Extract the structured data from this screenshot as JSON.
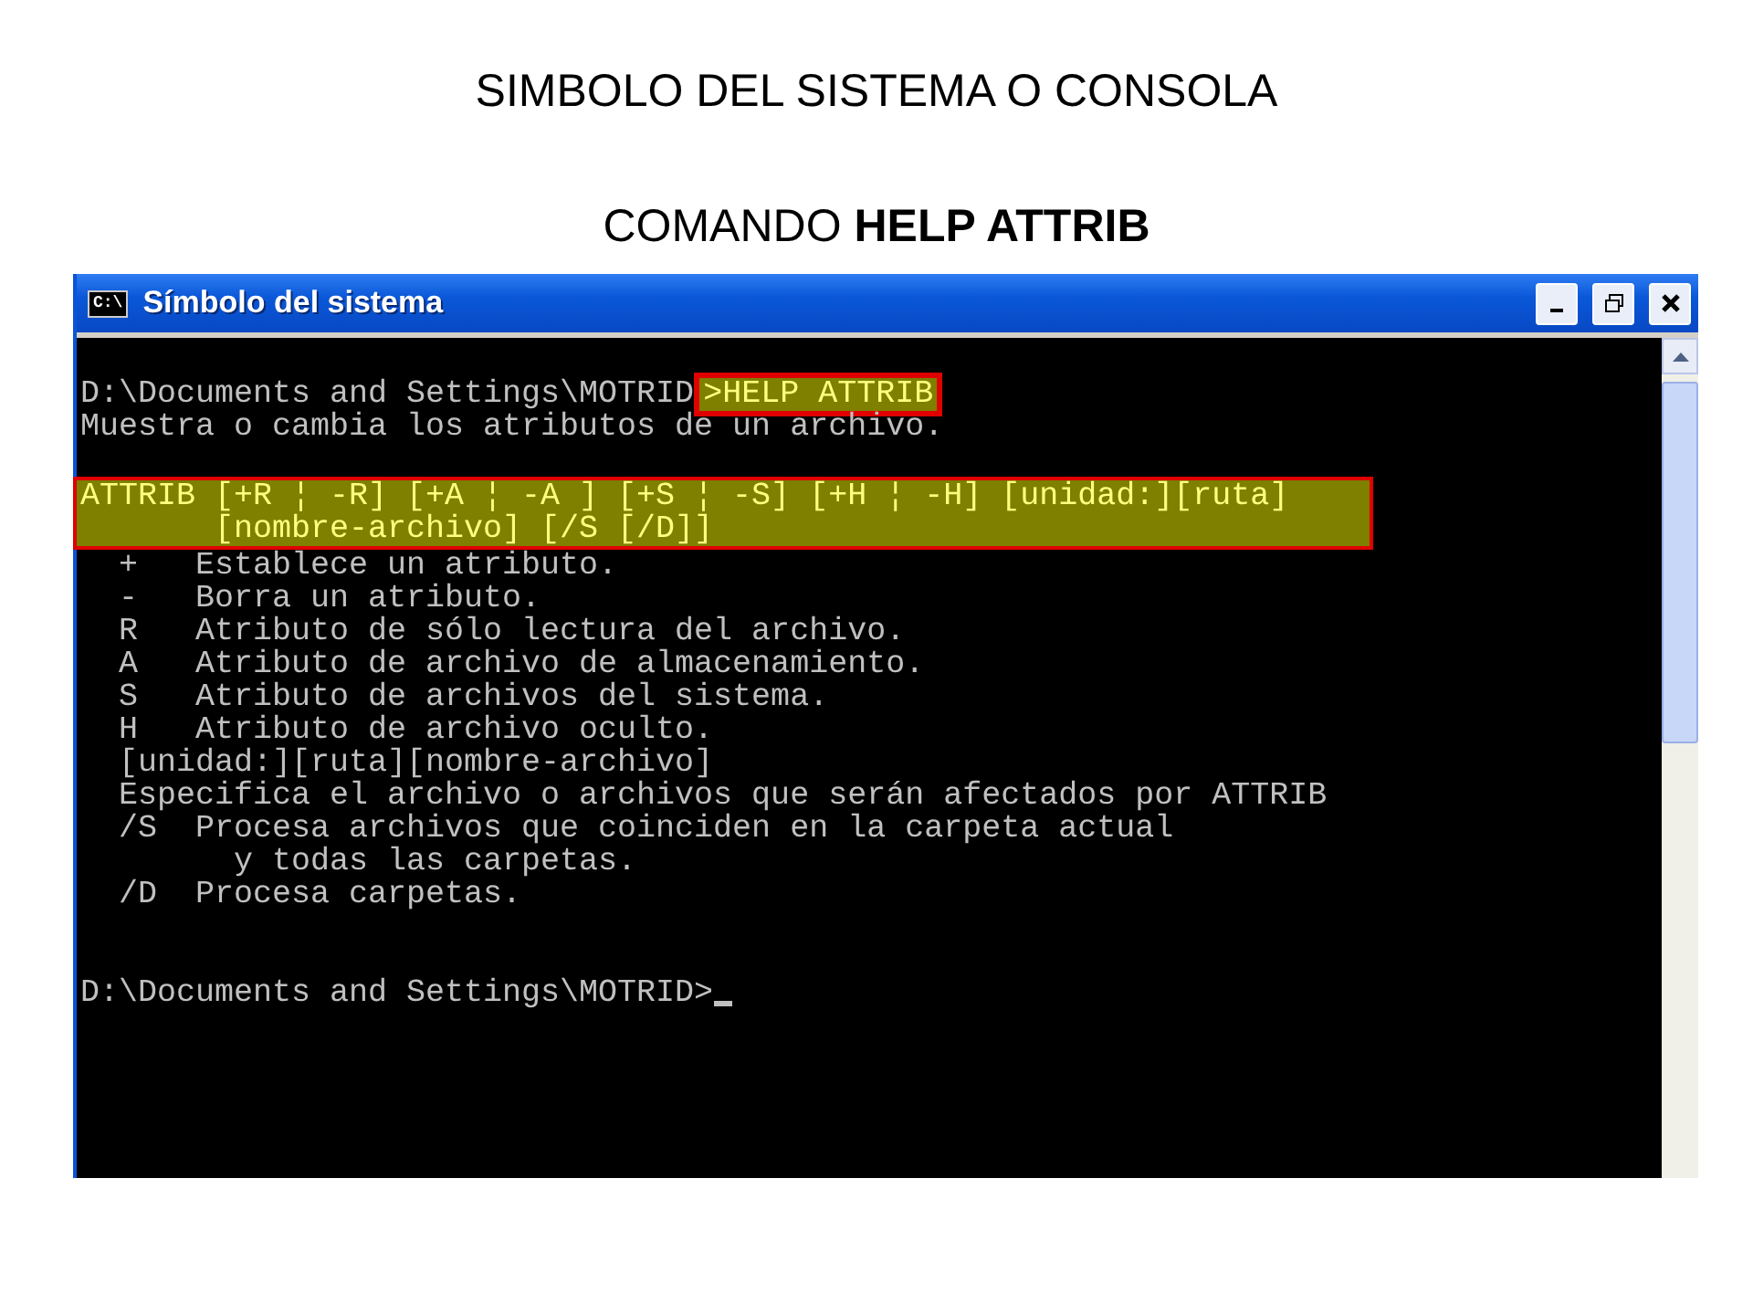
{
  "slide": {
    "title": "SIMBOLO DEL SISTEMA O CONSOLA",
    "subtitle": "COMANDO **HELP ATTRIB**"
  },
  "window": {
    "title": "Símbolo del sistema",
    "icon_text": "C:\\"
  },
  "console": {
    "lines": [
      {
        "kind": "command",
        "prompt": "D:\\Documents and Settings\\MOTRID",
        "command": ">HELP ATTRIB"
      },
      {
        "kind": "text",
        "text": "Muestra o cambia los atributos de un archivo."
      },
      {
        "kind": "blank"
      },
      {
        "kind": "highlight",
        "lines": [
          "ATTRIB [+R ¦ -R] [+A ¦ -A ] [+S ¦ -S] [+H ¦ -H] [unidad:][ruta]",
          "       [nombre-archivo] [/S [/D]]"
        ]
      },
      {
        "kind": "text",
        "text": "  +   Establece un atributo."
      },
      {
        "kind": "text",
        "text": "  -   Borra un atributo."
      },
      {
        "kind": "text",
        "text": "  R   Atributo de sólo lectura del archivo."
      },
      {
        "kind": "text",
        "text": "  A   Atributo de archivo de almacenamiento."
      },
      {
        "kind": "text",
        "text": "  S   Atributo de archivos del sistema."
      },
      {
        "kind": "text",
        "text": "  H   Atributo de archivo oculto."
      },
      {
        "kind": "text",
        "text": "  [unidad:][ruta][nombre-archivo]"
      },
      {
        "kind": "text",
        "text": "  Especifica el archivo o archivos que serán afectados por ATTRIB"
      },
      {
        "kind": "text",
        "text": "  /S  Procesa archivos que coinciden en la carpeta actual"
      },
      {
        "kind": "text",
        "text": "        y todas las carpetas."
      },
      {
        "kind": "text",
        "text": "  /D  Procesa carpetas."
      },
      {
        "kind": "blank"
      },
      {
        "kind": "blank"
      },
      {
        "kind": "prompt",
        "text": "D:\\Documents and Settings\\MOTRID>"
      }
    ]
  }
}
